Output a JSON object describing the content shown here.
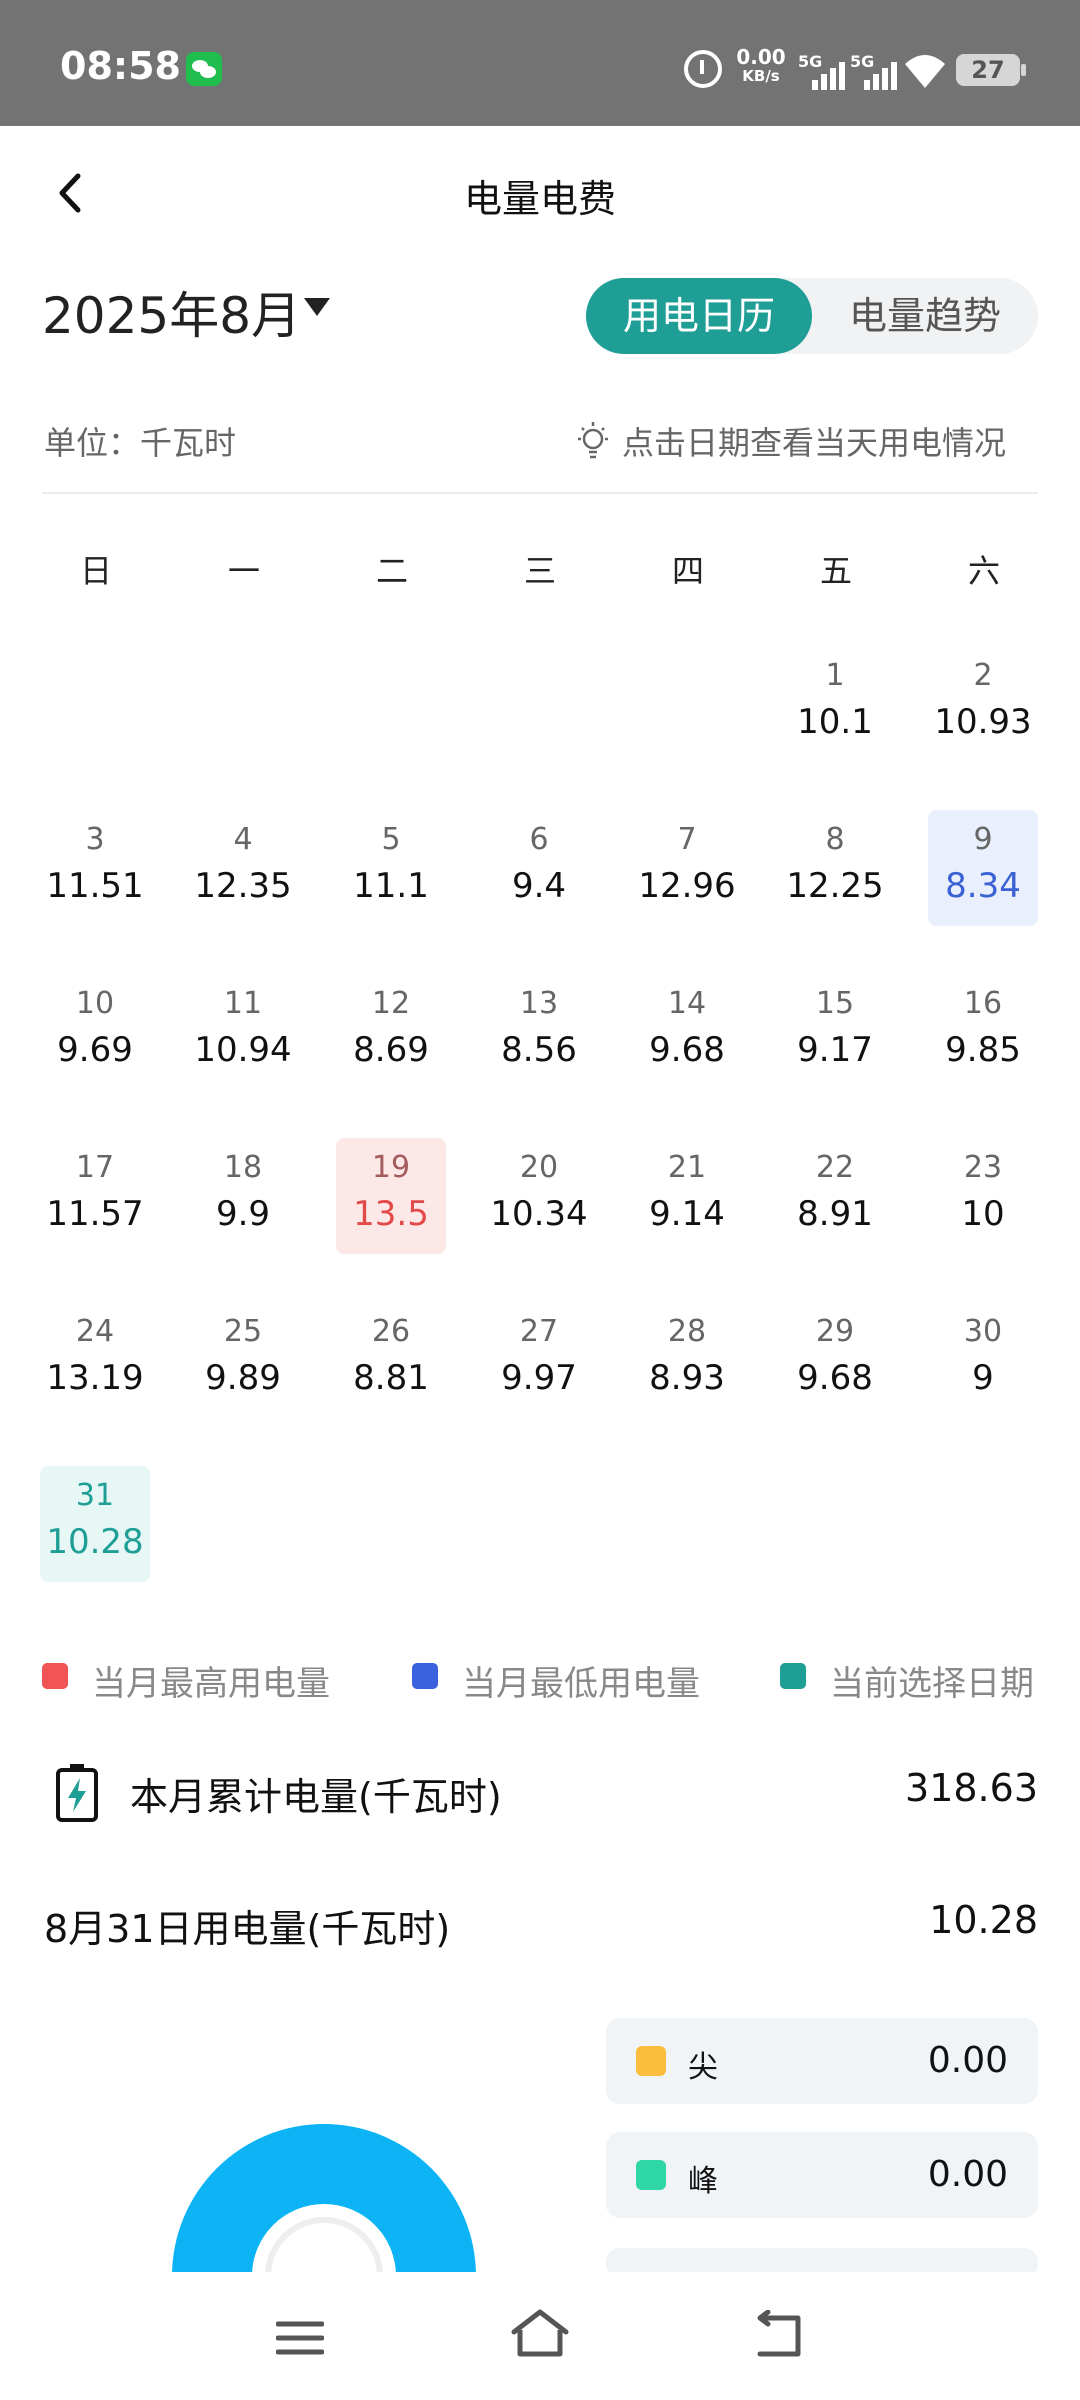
{
  "status_bar": {
    "time": "08:58",
    "net_speed_value": "0.00",
    "net_speed_unit": "KB/s",
    "signal_1_label": "5G",
    "signal_2_label": "5G",
    "battery_level": "27",
    "icons": [
      "wechat-icon",
      "alarm-icon",
      "signal-icon",
      "wifi-icon",
      "battery-icon"
    ]
  },
  "header": {
    "title": "电量电费",
    "back_icon": "chevron-left-icon"
  },
  "controls": {
    "month_label": "2025年8月",
    "tabs": [
      {
        "label": "用电日历",
        "active": true
      },
      {
        "label": "电量趋势",
        "active": false
      }
    ]
  },
  "info": {
    "unit": "单位：千瓦时",
    "hint": "点击日期查看当天用电情况"
  },
  "calendar": {
    "weekdays": [
      "日",
      "一",
      "二",
      "三",
      "四",
      "五",
      "六"
    ],
    "start_weekday_index": 5,
    "days": [
      {
        "day": "1",
        "value": "10.1"
      },
      {
        "day": "2",
        "value": "10.93"
      },
      {
        "day": "3",
        "value": "11.51"
      },
      {
        "day": "4",
        "value": "12.35"
      },
      {
        "day": "5",
        "value": "11.1"
      },
      {
        "day": "6",
        "value": "9.4"
      },
      {
        "day": "7",
        "value": "12.96"
      },
      {
        "day": "8",
        "value": "12.25"
      },
      {
        "day": "9",
        "value": "8.34",
        "state": "low"
      },
      {
        "day": "10",
        "value": "9.69"
      },
      {
        "day": "11",
        "value": "10.94"
      },
      {
        "day": "12",
        "value": "8.69"
      },
      {
        "day": "13",
        "value": "8.56"
      },
      {
        "day": "14",
        "value": "9.68"
      },
      {
        "day": "15",
        "value": "9.17"
      },
      {
        "day": "16",
        "value": "9.85"
      },
      {
        "day": "17",
        "value": "11.57"
      },
      {
        "day": "18",
        "value": "9.9"
      },
      {
        "day": "19",
        "value": "13.5",
        "state": "high"
      },
      {
        "day": "20",
        "value": "10.34"
      },
      {
        "day": "21",
        "value": "9.14"
      },
      {
        "day": "22",
        "value": "8.91"
      },
      {
        "day": "23",
        "value": "10"
      },
      {
        "day": "24",
        "value": "13.19"
      },
      {
        "day": "25",
        "value": "9.89"
      },
      {
        "day": "26",
        "value": "8.81"
      },
      {
        "day": "27",
        "value": "9.97"
      },
      {
        "day": "28",
        "value": "8.93"
      },
      {
        "day": "29",
        "value": "9.68"
      },
      {
        "day": "30",
        "value": "9"
      },
      {
        "day": "31",
        "value": "10.28",
        "state": "selected"
      }
    ]
  },
  "legend": [
    {
      "label": "当月最高用电量",
      "color": "#f05454"
    },
    {
      "label": "当月最低用电量",
      "color": "#3a62e0"
    },
    {
      "label": "当前选择日期",
      "color": "#1f9e96"
    }
  ],
  "summary": {
    "total_label": "本月累计电量(千瓦时)",
    "total_value": "318.63",
    "day_label": "8月31日用电量(千瓦时)",
    "day_value": "10.28",
    "total_icon": "battery-charging-icon"
  },
  "tou": [
    {
      "label": "尖",
      "value": "0.00",
      "color": "#fbbd3c"
    },
    {
      "label": "峰",
      "value": "0.00",
      "color": "#2fd6a6"
    }
  ],
  "colors": {
    "accent": "#1f9e96",
    "gauge": "#0db4f5"
  },
  "nav": {
    "icons": [
      "menu-icon",
      "home-icon",
      "back-icon"
    ]
  }
}
